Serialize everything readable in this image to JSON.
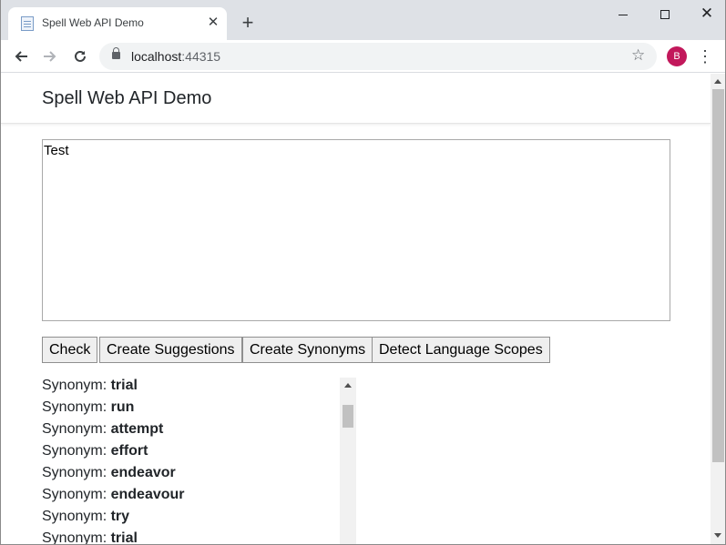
{
  "browser": {
    "tab_title": "Spell Web API Demo",
    "tab_close": "✕",
    "new_tab": "+",
    "url_host": "localhost",
    "url_port": ":44315",
    "avatar_letter": "B",
    "menu_glyph": "⋮",
    "star_glyph": "☆",
    "close_glyph": "✕"
  },
  "page": {
    "brand": "Spell Web API Demo",
    "input_text": "Test",
    "buttons": {
      "check": "Check",
      "create_suggestions": "Create Suggestions",
      "create_synonyms": "Create Synonyms",
      "detect_language_scopes": "Detect Language Scopes"
    },
    "results": [
      {
        "prefix": "Synonym: ",
        "word": "trial"
      },
      {
        "prefix": "Synonym: ",
        "word": "run"
      },
      {
        "prefix": "Synonym: ",
        "word": "attempt"
      },
      {
        "prefix": "Synonym: ",
        "word": "effort"
      },
      {
        "prefix": "Synonym: ",
        "word": "endeavor"
      },
      {
        "prefix": "Synonym: ",
        "word": "endeavour"
      },
      {
        "prefix": "Synonym: ",
        "word": "try"
      },
      {
        "prefix": "Synonym: ",
        "word": "trial"
      }
    ]
  }
}
